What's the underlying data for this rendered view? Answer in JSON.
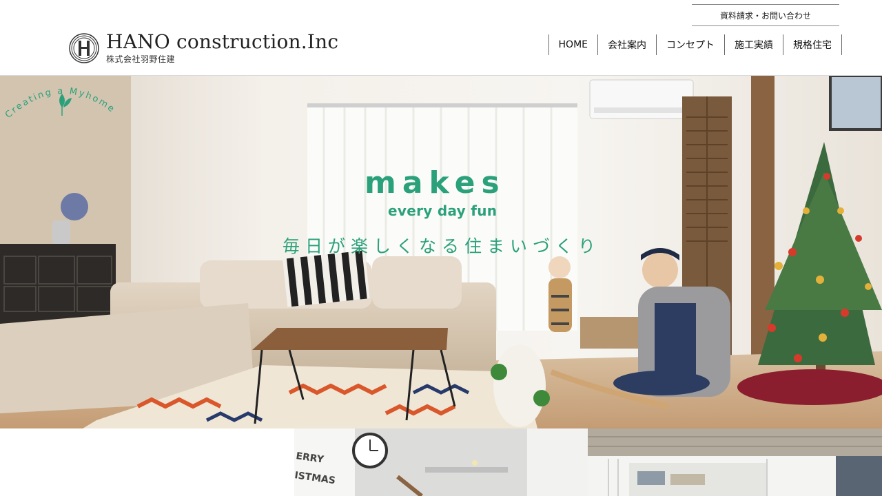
{
  "header": {
    "logo_en": "HANO construction.Inc",
    "logo_ja": "株式会社羽野住建",
    "request_label": "資料請求・お問い合わせ",
    "nav": [
      "HOME",
      "会社案内",
      "コンセプト",
      "施工実績",
      "規格住宅"
    ]
  },
  "hero": {
    "arc_text": "Creating a Myhome",
    "title": "makes",
    "subtitle": "every day fun",
    "tagline": "毎日が楽しくなる住まいづくり",
    "accent_color": "#2aa17a"
  },
  "thumbnails": {
    "merry_text": "ERRY",
    "christmas_text": "ISTMAS"
  }
}
